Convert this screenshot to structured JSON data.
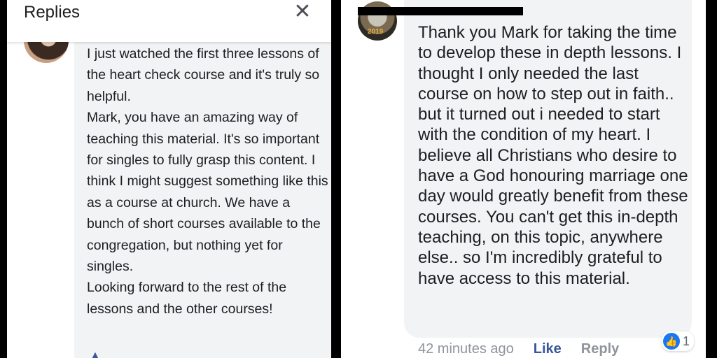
{
  "left_panel": {
    "header_title": "Replies",
    "close_label": "✕",
    "comment_paragraphs": [
      "I just watched the first three lessons of the heart check course and it's truly so helpful.",
      "Mark, you have an amazing way of teaching this material. It's so important for singles to fully grasp this content. I think I might suggest something like this as a course at church. We have a bunch of short courses available to the congregation, but nothing yet for singles.",
      "Looking forward to the rest of the lessons and the other courses!"
    ]
  },
  "right_panel": {
    "avatar_badge": "2019",
    "comment_text": "Thank you Mark for taking the time to develop these in depth lessons. I thought I only needed the last course on how to step out in faith.. but it turned out i needed to start with the condition of my heart. I believe all Christians who desire to have a God honouring marriage one day would greatly benefit from these courses. You can't get this in-depth teaching, on this topic, anywhere else.. so I'm incredibly grateful to have access to this material.",
    "timestamp": "42 minutes ago",
    "like_label": "Like",
    "reply_label": "Reply",
    "reaction_icon": "thumbs-up-icon",
    "reaction_count": "1"
  },
  "colors": {
    "bubble_bg": "#f2f3f5",
    "link_blue": "#385898",
    "meta_gray": "#90949c",
    "reaction_blue": "#1877f2"
  }
}
